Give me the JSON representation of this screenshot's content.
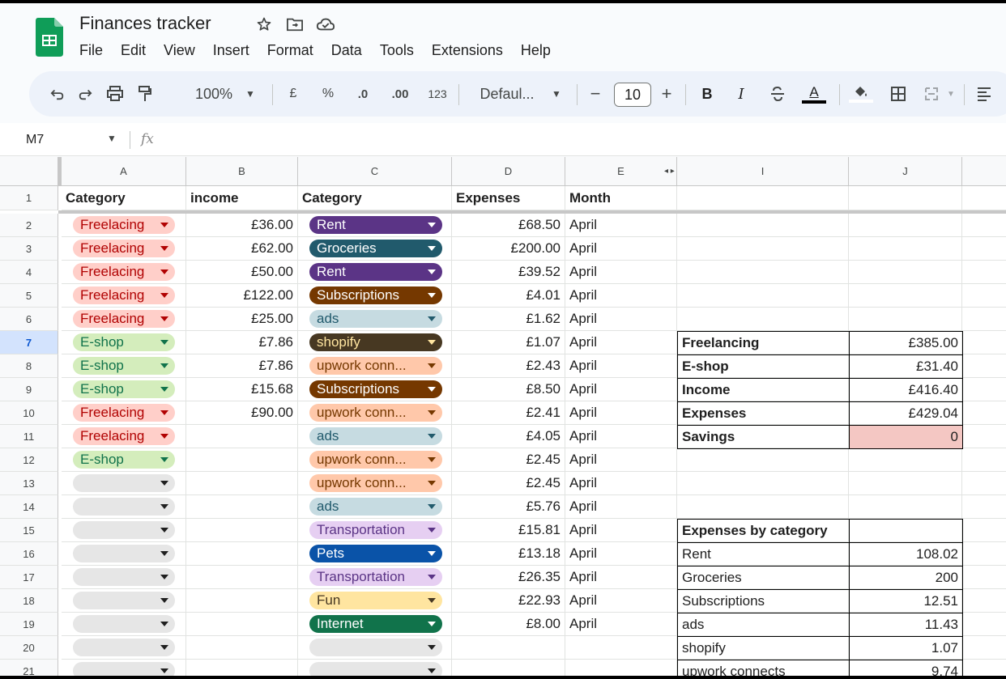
{
  "app": {
    "title": "Finances tracker",
    "menu": [
      "File",
      "Edit",
      "View",
      "Insert",
      "Format",
      "Data",
      "Tools",
      "Extensions",
      "Help"
    ]
  },
  "toolbar": {
    "zoom": "100%",
    "currency": "£",
    "percent": "%",
    "dec_decrease": ".0",
    "dec_increase": ".00",
    "number_format": "123",
    "font": "Defaul...",
    "font_size": "10",
    "minus": "−",
    "plus": "+",
    "bold": "B",
    "italic": "I",
    "text_color": "A"
  },
  "formula_bar": {
    "cell_ref": "M7",
    "fx": "fx"
  },
  "columns": [
    "A",
    "B",
    "C",
    "D",
    "E",
    "I",
    "J"
  ],
  "rows": [
    "1",
    "2",
    "3",
    "4",
    "5",
    "6",
    "7",
    "8",
    "9",
    "10",
    "11",
    "12",
    "13",
    "14",
    "15",
    "16",
    "17",
    "18",
    "19",
    "20",
    "21"
  ],
  "headers": [
    "Category",
    "income",
    "Category",
    "Expenses",
    "Month"
  ],
  "colors": {
    "freelancing_chip": "#ffcfc9",
    "freelancing_text": "#b10202",
    "eshop_chip": "#d4edbc",
    "eshop_text": "#11734b",
    "empty_chip": "#e6e6e6",
    "savings_fill": "#f4c7c3"
  },
  "data_rows": [
    {
      "a": "Freelacing",
      "b": "£36.00",
      "c": "Rent",
      "d": "£68.50",
      "e": "April"
    },
    {
      "a": "Freelacing",
      "b": "£62.00",
      "c": "Groceries",
      "d": "£200.00",
      "e": "April"
    },
    {
      "a": "Freelacing",
      "b": "£50.00",
      "c": "Rent",
      "d": "£39.52",
      "e": "April"
    },
    {
      "a": "Freelacing",
      "b": "£122.00",
      "c": "Subscriptions",
      "d": "£4.01",
      "e": "April"
    },
    {
      "a": "Freelacing",
      "b": "£25.00",
      "c": "ads",
      "d": "£1.62",
      "e": "April"
    },
    {
      "a": "E-shop",
      "b": "£7.86",
      "c": "shopify",
      "d": "£1.07",
      "e": "April"
    },
    {
      "a": "E-shop",
      "b": "£7.86",
      "c": "upwork conn...",
      "d": "£2.43",
      "e": "April"
    },
    {
      "a": "E-shop",
      "b": "£15.68",
      "c": "Subscriptions",
      "d": "£8.50",
      "e": "April"
    },
    {
      "a": "Freelacing",
      "b": "£90.00",
      "c": "upwork conn...",
      "d": "£2.41",
      "e": "April"
    },
    {
      "a": "Freelacing",
      "b": "",
      "c": "ads",
      "d": "£4.05",
      "e": "April"
    },
    {
      "a": "E-shop",
      "b": "",
      "c": "upwork conn...",
      "d": "£2.45",
      "e": "April"
    },
    {
      "a": "",
      "b": "",
      "c": "upwork conn...",
      "d": "£2.45",
      "e": "April"
    },
    {
      "a": "",
      "b": "",
      "c": "ads",
      "d": "£5.76",
      "e": "April"
    },
    {
      "a": "",
      "b": "",
      "c": "Transportation",
      "d": "£15.81",
      "e": "April"
    },
    {
      "a": "",
      "b": "",
      "c": "Pets",
      "d": "£13.18",
      "e": "April"
    },
    {
      "a": "",
      "b": "",
      "c": "Transportation",
      "d": "£26.35",
      "e": "April"
    },
    {
      "a": "",
      "b": "",
      "c": "Fun",
      "d": "£22.93",
      "e": "April"
    },
    {
      "a": "",
      "b": "",
      "c": "Internet",
      "d": "£8.00",
      "e": "April"
    },
    {
      "a": "",
      "b": "",
      "c": "",
      "d": "",
      "e": ""
    },
    {
      "a": "",
      "b": "",
      "c": "",
      "d": "",
      "e": ""
    }
  ],
  "category_chip_colors": {
    "Rent": {
      "bg": "#5b3486",
      "fg": "#ffffff"
    },
    "Groceries": {
      "bg": "#215a6c",
      "fg": "#ffffff"
    },
    "Subscriptions": {
      "bg": "#753800",
      "fg": "#ffffff"
    },
    "ads": {
      "bg": "#c6dbe1",
      "fg": "#215a6c"
    },
    "shopify": {
      "bg": "#473822",
      "fg": "#ffe5a0"
    },
    "upwork conn...": {
      "bg": "#ffc8aa",
      "fg": "#753800"
    },
    "Transportation": {
      "bg": "#e6cff2",
      "fg": "#5b3486"
    },
    "Pets": {
      "bg": "#0a53a8",
      "fg": "#ffffff"
    },
    "Fun": {
      "bg": "#ffe5a0",
      "fg": "#473822"
    },
    "Internet": {
      "bg": "#11734b",
      "fg": "#ffffff"
    },
    "": {
      "bg": "#e6e6e6",
      "fg": "#1f1f1f"
    }
  },
  "summary": [
    {
      "label": "Freelancing",
      "value": "£385.00"
    },
    {
      "label": "E-shop",
      "value": "£31.40"
    },
    {
      "label": "Income",
      "value": "£416.40"
    },
    {
      "label": "Expenses",
      "value": "£429.04"
    },
    {
      "label": "Savings",
      "value": "0"
    }
  ],
  "expenses_by_category": {
    "title": "Expenses by category",
    "items": [
      {
        "label": "Rent",
        "value": "108.02"
      },
      {
        "label": "Groceries",
        "value": "200"
      },
      {
        "label": "Subscriptions",
        "value": "12.51"
      },
      {
        "label": "ads",
        "value": "11.43"
      },
      {
        "label": "shopify",
        "value": "1.07"
      },
      {
        "label": "upwork connects",
        "value": "9.74"
      }
    ]
  }
}
